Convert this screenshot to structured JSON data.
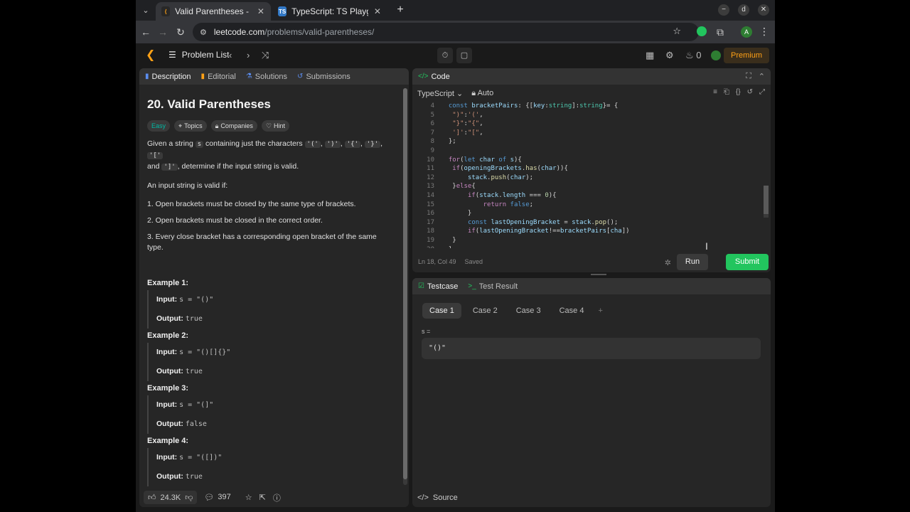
{
  "browser": {
    "tabs": [
      {
        "title": "Valid Parentheses - LeetCode",
        "favicon": "leetcode-icon",
        "active": true
      },
      {
        "title": "TypeScript: TS Playground",
        "favicon": "typescript-icon",
        "active": false
      }
    ],
    "url_host": "leetcode.com",
    "url_path": "/problems/valid-parentheses/",
    "account_initial": "A",
    "profile_initial": "d"
  },
  "lc_header": {
    "problem_list": "Problem List",
    "streak_count": "0",
    "premium": "Premium"
  },
  "left": {
    "tabs": [
      "Description",
      "Editorial",
      "Solutions",
      "Submissions"
    ],
    "title": "20. Valid Parentheses",
    "chips": [
      "Easy",
      "Topics",
      "Companies",
      "Hint"
    ],
    "intro_a": "Given a string ",
    "intro_s": "s",
    "intro_b": " containing just the characters ",
    "chars": [
      "'('",
      "')'",
      "'{'",
      "'}'",
      "'['",
      "']'"
    ],
    "intro_and": "and ",
    "intro_c": ", determine if the input string is valid.",
    "valid_if": "An input string is valid if:",
    "rules": [
      "1. Open brackets must be closed by the same type of brackets.",
      "2. Open brackets must be closed in the correct order.",
      "3. Every close bracket has a corresponding open bracket of the same type."
    ],
    "examples": [
      {
        "heading": "Example 1:",
        "input": "s = \"()\"",
        "output": "true"
      },
      {
        "heading": "Example 2:",
        "input": "s = \"()[]{}\"",
        "output": "true"
      },
      {
        "heading": "Example 3:",
        "input": "s = \"(]\"",
        "output": "false"
      },
      {
        "heading": "Example 4:",
        "input": "s = \"([])\"",
        "output": "true"
      }
    ],
    "input_label": "Input:",
    "output_label": "Output:",
    "likes": "24.3K",
    "comments": "397"
  },
  "code": {
    "tab": "Code",
    "language": "TypeScript",
    "auto": "Auto",
    "lines": [
      {
        "n": "4",
        "html": "  <span class='k'>const</span> <span class='vv'>bracketPairs</span>: {[<span class='vv'>key</span>:<span class='t'>string</span>]:<span class='t'>string</span>}= {"
      },
      {
        "n": "5",
        "html": "   <span class='s'>\")\"</span>:<span class='s'>'('</span>,"
      },
      {
        "n": "6",
        "html": "   <span class='s'>\"}\"</span>:<span class='s'>\"{\"</span>,"
      },
      {
        "n": "7",
        "html": "   <span class='s'>']'</span>:<span class='s'>\"[\"</span>,"
      },
      {
        "n": "8",
        "html": "  };"
      },
      {
        "n": "9",
        "html": ""
      },
      {
        "n": "10",
        "html": "  <span class='kw2'>for</span>(<span class='k'>let</span> <span class='vv'>char</span> <span class='k'>of</span> <span class='vv'>s</span>){"
      },
      {
        "n": "11",
        "html": "   <span class='kw2'>if</span>(<span class='vv'>openingBrackets</span>.<span class='f'>has</span>(<span class='vv'>char</span>)){"
      },
      {
        "n": "12",
        "html": "       <span class='vv'>stack</span>.<span class='f'>push</span>(<span class='vv'>char</span>);"
      },
      {
        "n": "13",
        "html": "   }<span class='kw2'>else</span>{"
      },
      {
        "n": "14",
        "html": "       <span class='kw2'>if</span>(<span class='vv'>stack</span>.<span class='vv'>length</span> === <span class='n'>0</span>){"
      },
      {
        "n": "15",
        "html": "           <span class='kw2'>return</span> <span class='k'>false</span>;"
      },
      {
        "n": "16",
        "html": "       }"
      },
      {
        "n": "17",
        "html": "       <span class='k'>const</span> <span class='vv'>lastOpeningBracket</span> = <span class='vv'>stack</span>.<span class='f'>pop</span>();"
      },
      {
        "n": "18",
        "html": "       <span class='kw2'>if</span>(<span class='vv'>lastOpeningBracket</span>!==<span class='vv'>bracketPairs</span>[<span class='vv'>cha</span>])"
      },
      {
        "n": "19",
        "html": "   }"
      },
      {
        "n": "20",
        "html": "  }"
      }
    ],
    "status": "Ln 18, Col 49",
    "saved": "Saved",
    "run": "Run",
    "submit": "Submit"
  },
  "test": {
    "tabs": [
      "Testcase",
      "Test Result"
    ],
    "cases": [
      "Case 1",
      "Case 2",
      "Case 3",
      "Case 4"
    ],
    "add": "+",
    "var_label": "s =",
    "var_value": "\"()\"",
    "source": "Source"
  },
  "colors": {
    "accent": "#ffa116",
    "submit": "#22c55e",
    "easy": "#00b8a3"
  }
}
